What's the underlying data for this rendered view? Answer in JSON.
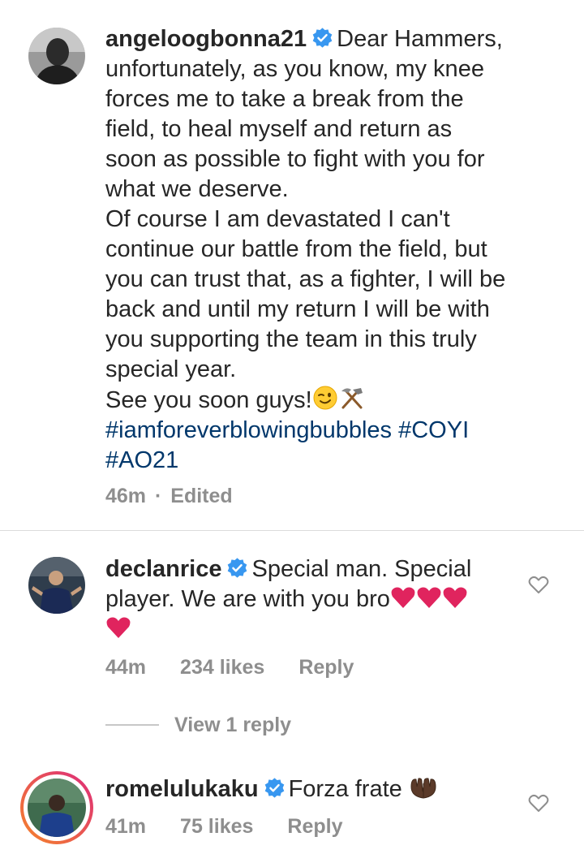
{
  "comments": [
    {
      "username": "angeloogbonna21",
      "verified": true,
      "text_line1": "Dear Hammers,",
      "text_lines": [
        "unfortunately, as you know, my knee",
        "forces me to take a break from the",
        "field, to heal myself and return as",
        "soon as possible to fight with you for",
        "what we deserve.",
        "Of course I am devastated I can't",
        "continue our battle from the field, but",
        "you can trust that, as a fighter, I will be",
        "back and until my return I will be with",
        "you supporting the team in this truly",
        "special year.",
        "See you soon guys!"
      ],
      "hashtags_line1": "#iamforeverblowingbubbles #COYI",
      "hashtags_line2": "#AO21",
      "time": "46m",
      "separator": "·",
      "edited": "Edited"
    },
    {
      "username": "declanrice",
      "verified": true,
      "text_line1": "Special man. Special",
      "text_line2": "player. We are with you bro",
      "time": "44m",
      "likes": "234 likes",
      "reply": "Reply",
      "view_replies": "View 1 reply"
    },
    {
      "username": "romelulukaku",
      "verified": true,
      "text_line1": "Forza frate",
      "time": "41m",
      "likes": "75 likes",
      "reply": "Reply"
    }
  ],
  "colors": {
    "verified": "#3897f0",
    "hashtag": "#00376b",
    "meta": "#8e8e8e",
    "heart": "#e0245e",
    "story_ring_start": "#f58529",
    "story_ring_end": "#dd2a7b"
  },
  "icons": {
    "verified": "verified-badge-icon",
    "like": "heart-outline-icon",
    "wink": "winking-face-emoji",
    "hammers": "hammer-pick-emoji",
    "red_heart": "red-heart-emoji",
    "hands": "palms-up-together-emoji"
  }
}
